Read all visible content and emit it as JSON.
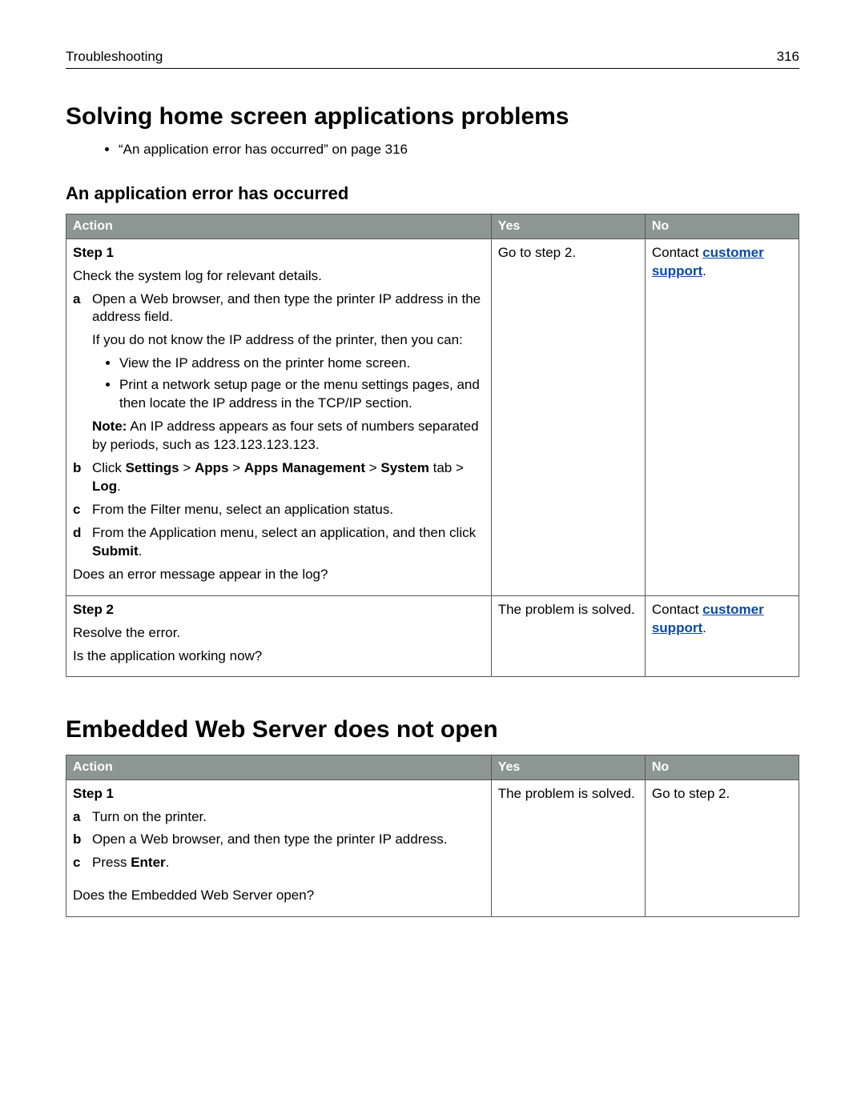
{
  "header": {
    "section": "Troubleshooting",
    "page": "316"
  },
  "h1": "Solving home screen applications problems",
  "toc": {
    "item1": "“An application error has occurred” on page 316"
  },
  "section1": {
    "title": "An application error has occurred",
    "th_action": "Action",
    "th_yes": "Yes",
    "th_no": "No",
    "row1": {
      "step_label": "Step 1",
      "intro": "Check the system log for relevant details.",
      "a": "Open a Web browser, and then type the printer IP address in the address field.",
      "a_note": "If you do not know the IP address of the printer, then you can:",
      "a_b1": "View the IP address on the printer home screen.",
      "a_b2": "Print a network setup page or the menu settings pages, and then locate the IP address in the TCP/IP section.",
      "note_label": "Note:",
      "note_text": " An IP address appears as four sets of numbers separated by periods, such as 123.123.123.123.",
      "b_pre": "Click ",
      "b_path_settings": "Settings",
      "b_sep": " > ",
      "b_path_apps": "Apps",
      "b_path_appsmgmt": "Apps Management",
      "b_path_system": "System",
      "b_tab": " tab > ",
      "b_log": "Log",
      "b_end": ".",
      "c": "From the Filter menu, select an application status.",
      "d_pre": "From the Application menu, select an application, and then click ",
      "d_bold": "Submit",
      "d_end": ".",
      "question": "Does an error message appear in the log?",
      "yes": "Go to step 2.",
      "no_pre": "Contact ",
      "no_link": "customer support",
      "no_post": "."
    },
    "row2": {
      "step_label": "Step 2",
      "line": "Resolve the error.",
      "question": "Is the application working now?",
      "yes": "The problem is solved.",
      "no_pre": "Contact ",
      "no_link": "customer support",
      "no_post": "."
    }
  },
  "h1b": "Embedded Web Server does not open",
  "section2": {
    "th_action": "Action",
    "th_yes": "Yes",
    "th_no": "No",
    "row1": {
      "step_label": "Step 1",
      "a": "Turn on the printer.",
      "b": "Open a Web browser, and then type the printer IP address.",
      "c_pre": "Press ",
      "c_bold": "Enter",
      "c_end": ".",
      "question": "Does the Embedded Web Server open?",
      "yes": "The problem is solved.",
      "no": "Go to step 2."
    }
  }
}
